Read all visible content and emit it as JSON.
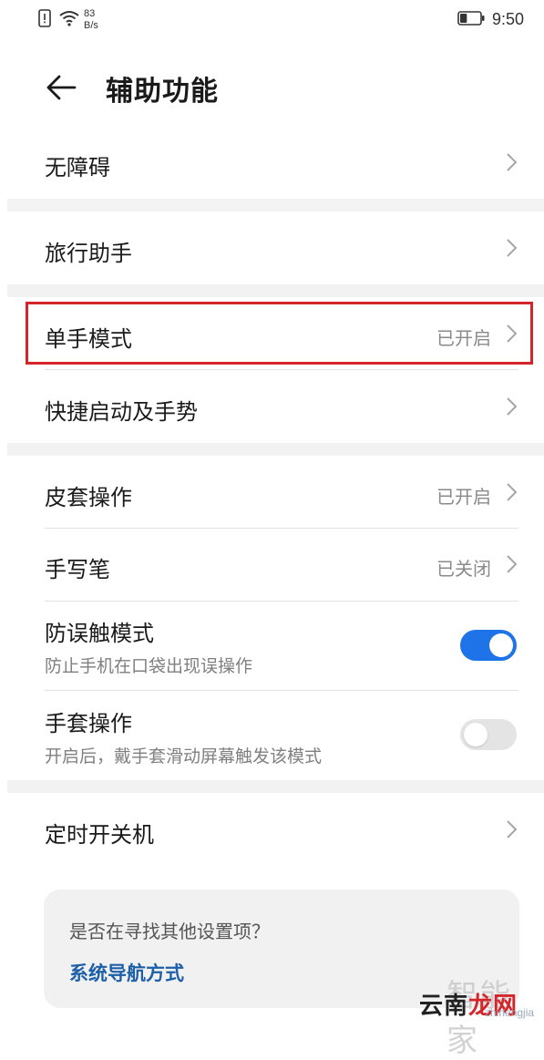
{
  "status_bar": {
    "net_speed_value": "83",
    "net_speed_unit": "B/s",
    "time": "9:50",
    "battery_level": 0.35
  },
  "header": {
    "title": "辅助功能"
  },
  "groups": [
    {
      "items": [
        {
          "label": "无障碍"
        }
      ]
    },
    {
      "items": [
        {
          "label": "旅行助手"
        }
      ]
    },
    {
      "items": [
        {
          "label": "单手模式",
          "status": "已开启"
        },
        {
          "label": "快捷启动及手势"
        }
      ]
    },
    {
      "items": [
        {
          "label": "皮套操作",
          "status": "已开启"
        },
        {
          "label": "手写笔",
          "status": "已关闭"
        },
        {
          "label": "防误触模式",
          "subtitle": "防止手机在口袋出现误操作",
          "toggle": true
        },
        {
          "label": "手套操作",
          "subtitle": "开启后，戴手套滑动屏幕触发该模式",
          "toggle": false
        }
      ]
    },
    {
      "items": [
        {
          "label": "定时开关机"
        }
      ]
    }
  ],
  "suggestion": {
    "question": "是否在寻找其他设置项？",
    "link": "系统导航方式"
  },
  "watermark": {
    "back_text": "智能家",
    "front_a": "云南",
    "front_b": "龙网",
    "url": "zhinengjia"
  },
  "colors": {
    "accent": "#1e73e8",
    "highlight": "#d4252a",
    "link": "#1d5fa8"
  }
}
